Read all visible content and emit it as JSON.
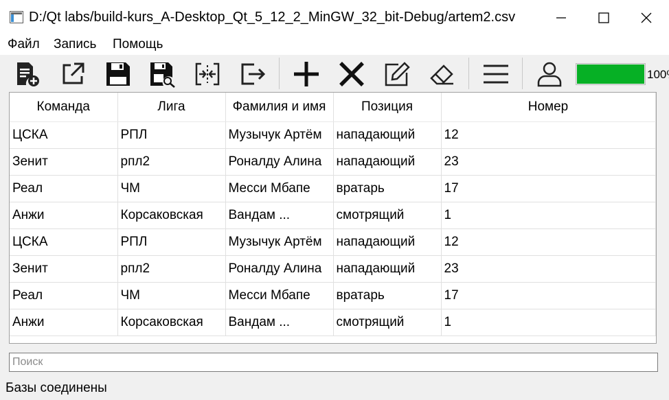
{
  "window": {
    "title": "D:/Qt labs/build-kurs_A-Desktop_Qt_5_12_2_MinGW_32_bit-Debug/artem2.csv"
  },
  "menu": [
    {
      "label": "Файл"
    },
    {
      "label": "Запись"
    },
    {
      "label": "Помощь"
    }
  ],
  "toolbar": {
    "icons": [
      "new-database-icon",
      "open-external-icon",
      "save-icon",
      "save-as-icon",
      "merge-icon",
      "exit-icon",
      "add-icon",
      "delete-icon",
      "edit-icon",
      "eraser-icon",
      "menu-icon",
      "user-icon"
    ]
  },
  "progress": {
    "value": 100,
    "text": "100%"
  },
  "table": {
    "columns": [
      "Команда",
      "Лига",
      "Фамилия и имя",
      "Позиция",
      "Номер"
    ],
    "rows": [
      [
        "ЦСКА",
        "РПЛ",
        "Музычук Артём",
        "нападающий",
        "12"
      ],
      [
        "Зенит",
        "рпл2",
        "Роналду Алина",
        "нападающий",
        "23"
      ],
      [
        "Реал",
        "ЧМ",
        "Месси Мбапе",
        "вратарь",
        "17"
      ],
      [
        "Анжи",
        "Корсаковская",
        "Вандам ...",
        "смотрящий",
        "1"
      ],
      [
        "ЦСКА",
        "РПЛ",
        "Музычук Артём",
        "нападающий",
        "12"
      ],
      [
        "Зенит",
        "рпл2",
        "Роналду Алина",
        "нападающий",
        "23"
      ],
      [
        "Реал",
        "ЧМ",
        "Месси Мбапе",
        "вратарь",
        "17"
      ],
      [
        "Анжи",
        "Корсаковская",
        "Вандам ...",
        "смотрящий",
        "1"
      ]
    ]
  },
  "search": {
    "placeholder": "Поиск",
    "value": ""
  },
  "status": {
    "text": "Базы соединены"
  },
  "colors": {
    "progress_fill": "#06b025"
  }
}
